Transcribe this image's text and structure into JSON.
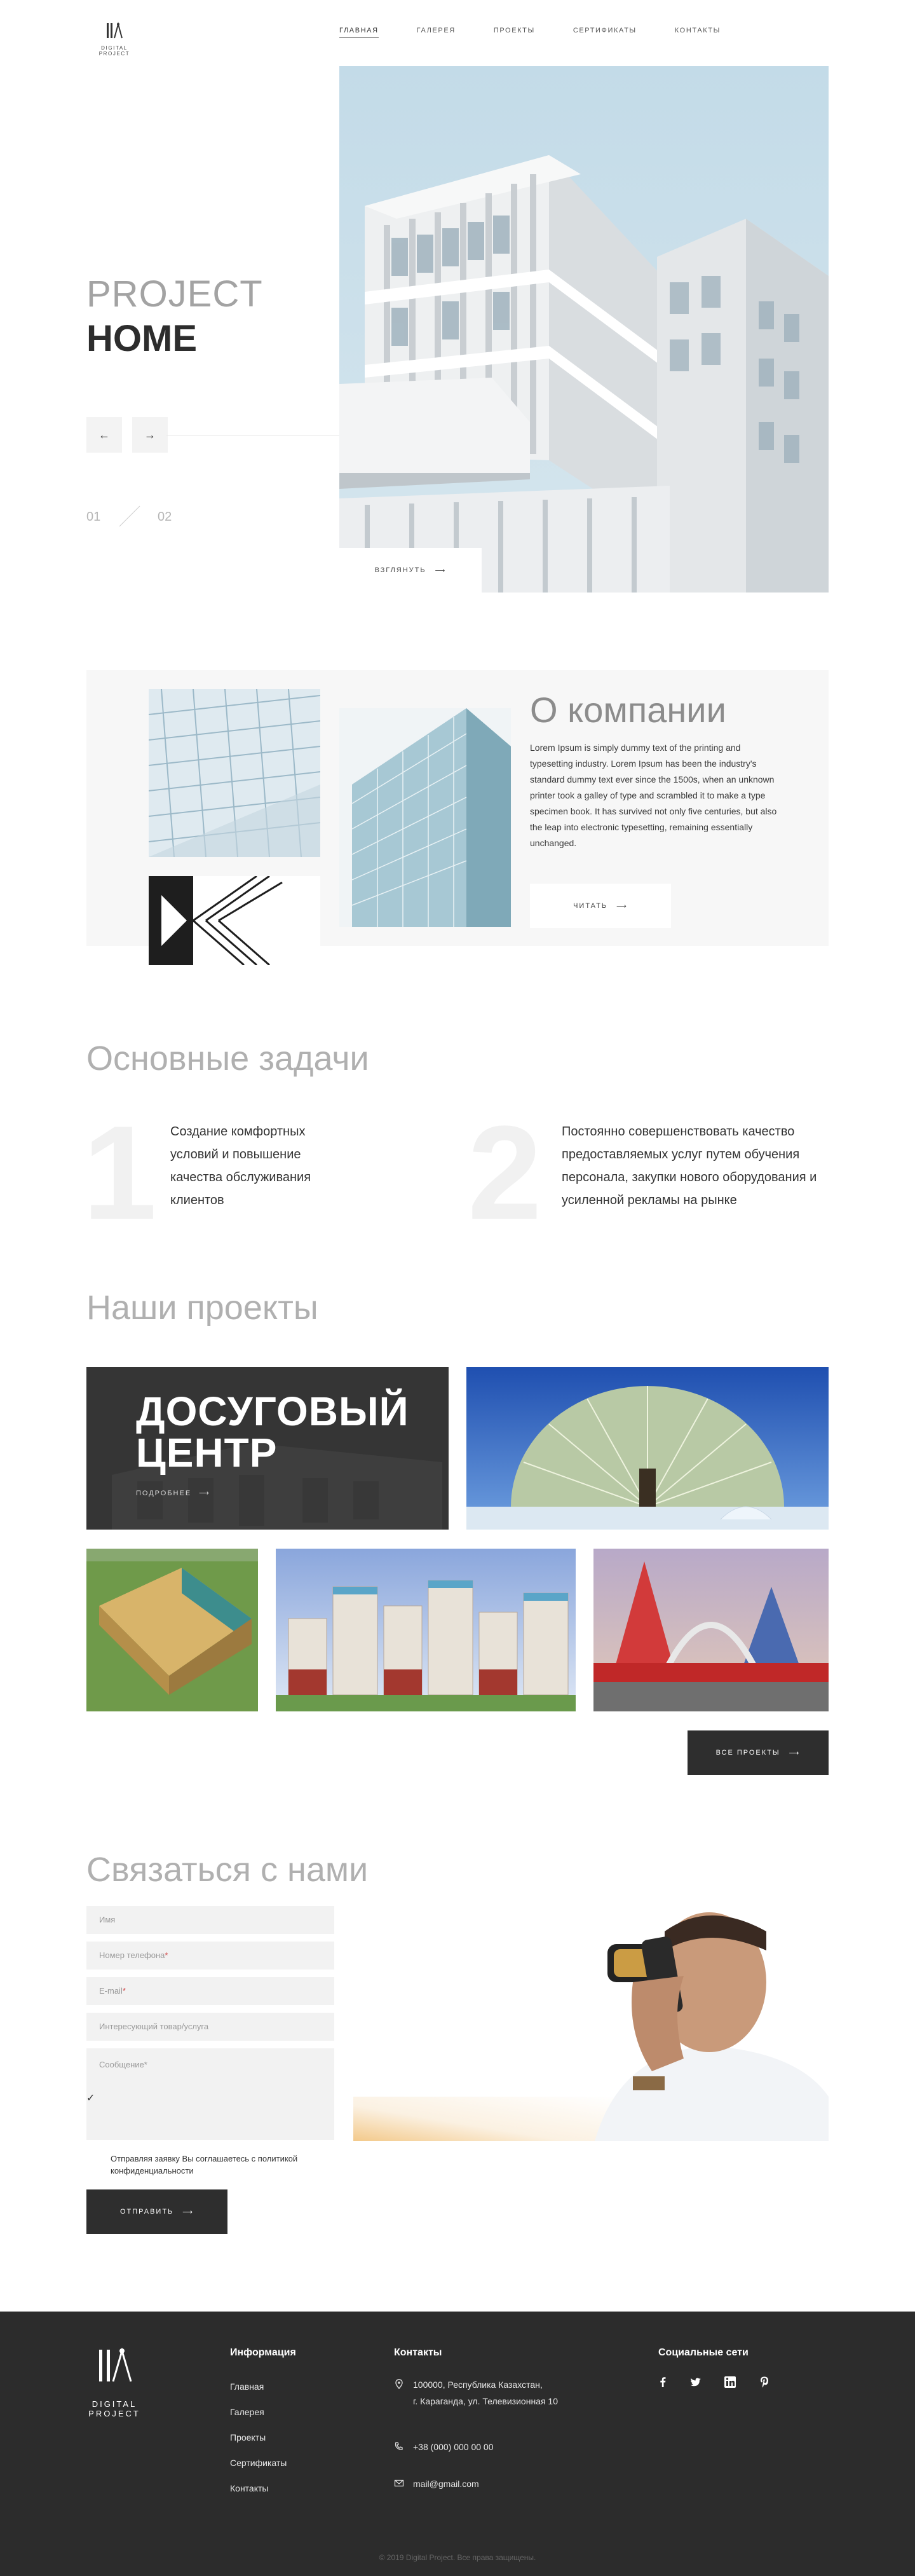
{
  "header": {
    "logo_text": "DIGITAL PROJECT",
    "nav": [
      {
        "label": "Главная",
        "active": true
      },
      {
        "label": "Галерея"
      },
      {
        "label": "Проекты"
      },
      {
        "label": "Сертификаты"
      },
      {
        "label": "Контакты"
      }
    ]
  },
  "hero": {
    "title_light": "PROJECT",
    "title_bold": "HOME",
    "prev_icon": "←",
    "next_icon": "→",
    "slide_current": "01",
    "slide_total": "02",
    "look_label": "Взглянуть",
    "look_icon": "⟶"
  },
  "about": {
    "title": "О компании",
    "text": "Lorem Ipsum is simply dummy text of the printing and typesetting industry. Lorem Ipsum has been the industry's standard dummy text ever since the 1500s, when an unknown printer took a galley of type and scrambled it to make a type specimen book. It has survived not only five centuries, but also the leap into electronic typesetting, remaining essentially unchanged.",
    "read_label": "Читать",
    "read_icon": "⟶"
  },
  "tasks": {
    "title": "Основные задачи",
    "items": [
      {
        "num": "1",
        "text": "Создание комфортных условий и повышение качества обслуживания клиентов"
      },
      {
        "num": "2",
        "text": "Постоянно совершенствовать качество предоставляемых услуг путем обучения персонала, закупки нового оборудования и усиленной рекламы на рынке"
      }
    ]
  },
  "projects": {
    "title": "Наши проекты",
    "featured_title": "ДОСУГОВЫЙ ЦЕНТР",
    "more_label": "Подробнее",
    "more_icon": "⟶",
    "all_label": "Все проекты",
    "all_icon": "⟶"
  },
  "contact": {
    "title": "Связаться с нами",
    "fields": [
      {
        "label": "Имя",
        "required": false
      },
      {
        "label": "Номер телефона",
        "required": true
      },
      {
        "label": "E-mail",
        "required": true
      },
      {
        "label": "Интересующий товар/услуга",
        "required": false
      }
    ],
    "message_label": "Сообщение",
    "req_mark": "*",
    "check_icon": "✓",
    "policy": "Отправляя заявку Вы соглашаетесь с политикой конфиденциальности",
    "send_label": "Отправить",
    "send_icon": "⟶"
  },
  "footer": {
    "logo_text": "DIGITAL PROJECT",
    "info_title": "Информация",
    "links": [
      "Главная",
      "Галерея",
      "Проекты",
      "Сертификаты",
      "Контакты"
    ],
    "contacts_title": "Контакты",
    "address_line1": "100000, Республика Казахстан,",
    "address_line2": "г. Караганда, ул. Телевизионная 10",
    "phone": "+38 (000) 000 00 00",
    "email": "mail@gmail.com",
    "social_title": "Социальные сети",
    "social_icons": [
      "facebook-icon",
      "twitter-icon",
      "linkedin-icon",
      "pinterest-icon"
    ],
    "copyright": "© 2019 Digital Project. Все права защищены."
  },
  "colors": {
    "dark": "#2c2c2c",
    "light_bg": "#f7f7f7",
    "sky": "#c8dde8",
    "grey_text": "#a3a3a3",
    "required": "#d24a4a"
  }
}
